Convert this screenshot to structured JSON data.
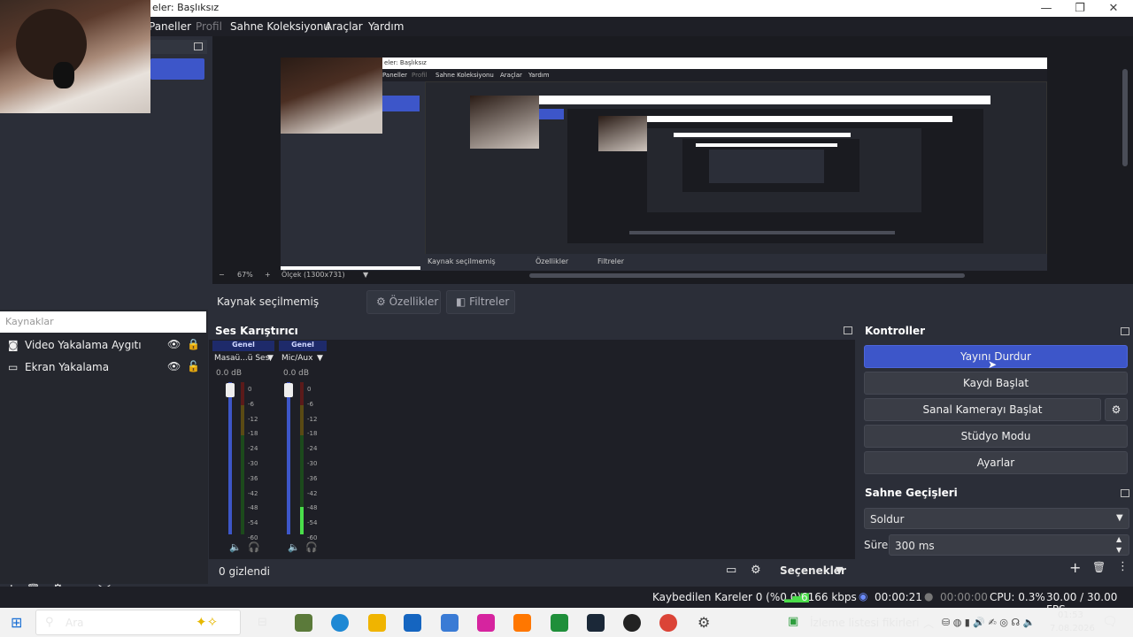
{
  "window": {
    "title": "eler: Başlıksız",
    "minimize": "—",
    "maximize": "❐",
    "close": "✕"
  },
  "menu": {
    "panels": "Paneller",
    "profile": "Profil",
    "scene_collection": "Sahne Koleksiyonu",
    "tools": "Araçlar",
    "help": "Yardım"
  },
  "preview": {
    "nested_title": "eler: Başlıksız",
    "nested_menu": [
      "Paneller",
      "Profil",
      "Sahne Koleksiyonu",
      "Araçlar",
      "Yardım"
    ],
    "zoom_minus": "−",
    "zoom": "67%",
    "zoom_plus": "+",
    "scale": "Ölçek (1300x731)",
    "nested_no_source": "Kaynak seçilmemiş",
    "nested_properties": "Özellikler",
    "nested_filters": "Filtreler"
  },
  "context": {
    "no_source": "Kaynak seçilmemiş",
    "properties": "Özellikler",
    "filters": "Filtreler"
  },
  "sources": {
    "title": "Kaynaklar",
    "items": [
      {
        "label": "Video Yakalama Aygıtı",
        "icon": "camera-icon"
      },
      {
        "label": "Ekran Yakalama",
        "icon": "monitor-icon"
      }
    ],
    "toolbar": {
      "add": "+",
      "remove": "🗑",
      "settings": "⚙",
      "up": "︿",
      "down": "﹀"
    }
  },
  "mixer": {
    "title": "Ses Karıştırıcı",
    "channels": [
      {
        "tag": "Genel",
        "name": "Masaü...ü Ses",
        "db": "0.0 dB",
        "level": 0
      },
      {
        "tag": "Genel",
        "name": "Mic/Aux",
        "db": "0.0 dB",
        "level": 0.18
      }
    ],
    "scale": [
      "0",
      "-6",
      "-12",
      "-18",
      "-24",
      "-30",
      "-36",
      "-42",
      "-48",
      "-54",
      "-60"
    ],
    "hidden": "0 gizlendi",
    "options": "Seçenekler"
  },
  "controls": {
    "title": "Kontroller",
    "stop_stream": "Yayını Durdur",
    "start_record": "Kaydı Başlat",
    "start_vcam": "Sanal Kamerayı Başlat",
    "studio_mode": "Stüdyo Modu",
    "settings": "Ayarlar"
  },
  "transitions": {
    "title": "Sahne Geçişleri",
    "selected": "Soldur",
    "duration_label": "Süre",
    "duration": "300 ms"
  },
  "status": {
    "dropped": "Kaybedilen Kareler 0 (%0.0)",
    "bitrate": "6166 kbps",
    "stream_time": "00:00:21",
    "record_time": "00:00:00",
    "cpu": "CPU: 0.3%",
    "fps": "30.00 / 30.00 FPS"
  },
  "taskbar": {
    "search": "Ara",
    "news": "İzleme listesi fikirleri",
    "time": "01:53",
    "date": "7.08.2026"
  },
  "colors": {
    "accent": "#3d56c9",
    "bg": "#2b2e38",
    "dark": "#1e1f26"
  }
}
